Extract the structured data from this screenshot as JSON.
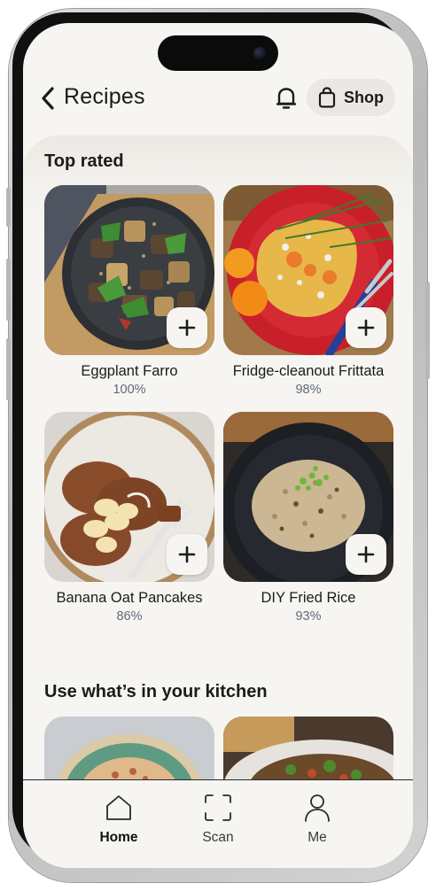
{
  "header": {
    "title": "Recipes",
    "shop_label": "Shop"
  },
  "sections": {
    "top_rated": {
      "title": "Top rated",
      "recipes": [
        {
          "name": "Eggplant Farro",
          "rating": "100%"
        },
        {
          "name": "Fridge-cleanout Frittata",
          "rating": "98%"
        },
        {
          "name": "Banana Oat Pancakes",
          "rating": "86%"
        },
        {
          "name": "DIY Fried Rice",
          "rating": "93%"
        }
      ]
    },
    "kitchen": {
      "title": "Use what’s in your kitchen"
    }
  },
  "tabbar": {
    "tabs": [
      {
        "label": "Home",
        "icon": "home-icon",
        "active": true
      },
      {
        "label": "Scan",
        "icon": "scan-icon",
        "active": false
      },
      {
        "label": "Me",
        "icon": "profile-icon",
        "active": false
      }
    ]
  },
  "colors": {
    "background": "#f7f5f2",
    "chip": "#ebe8e3",
    "rating_text": "#5f6a78"
  }
}
